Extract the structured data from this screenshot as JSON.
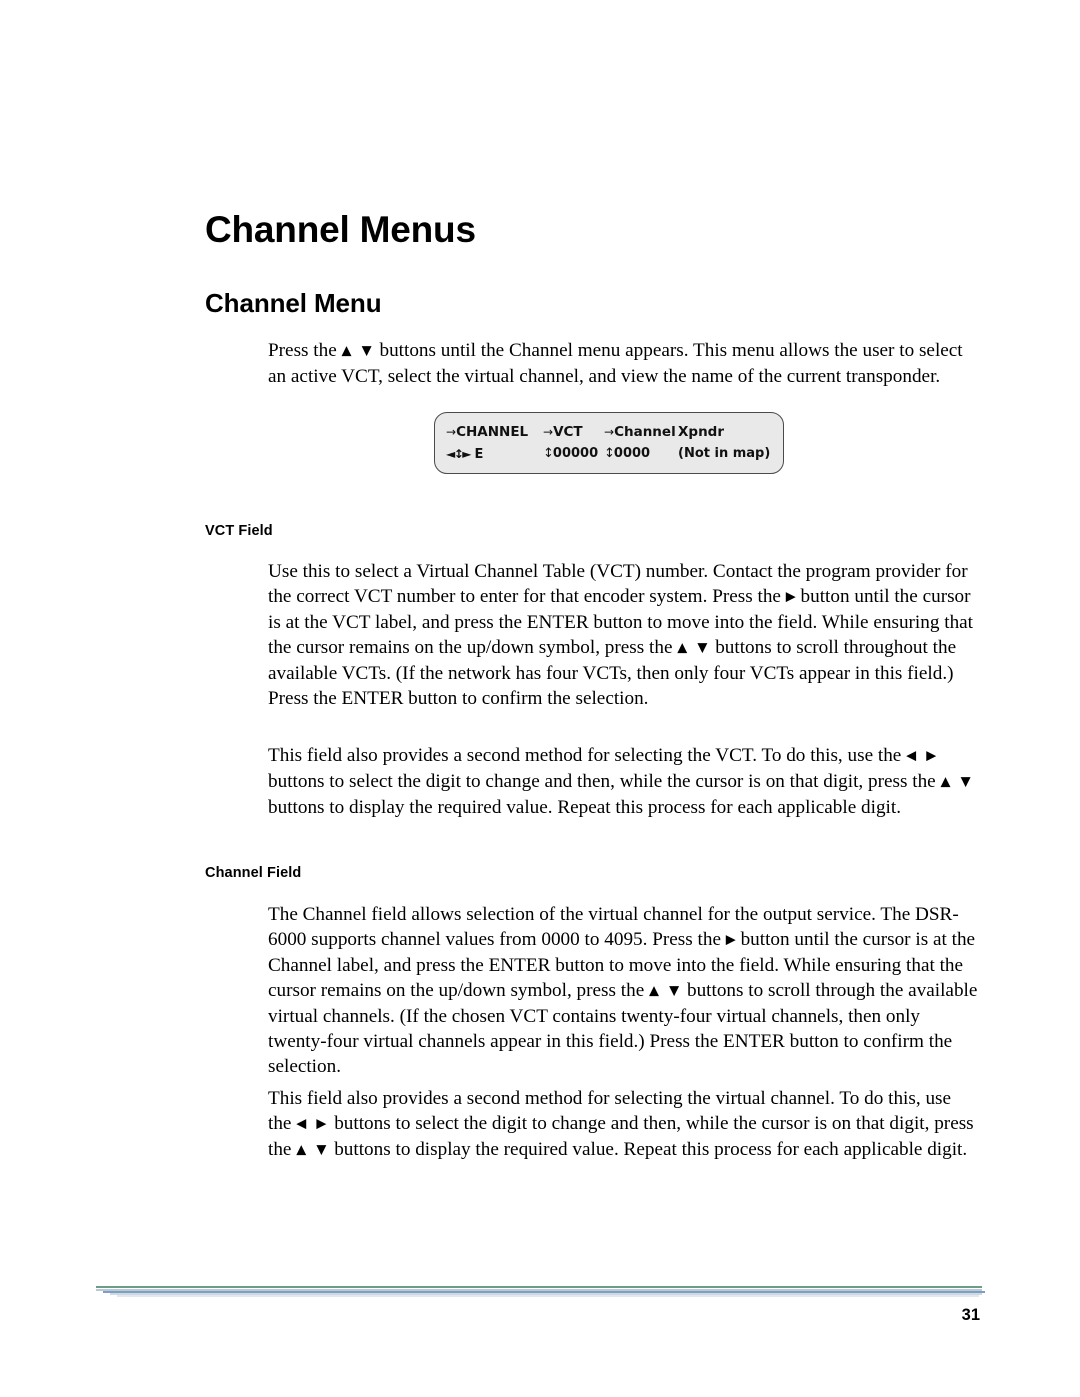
{
  "document": {
    "chapter_title": "Channel Menus",
    "section_title": "Channel Menu",
    "page_number": "31"
  },
  "intro": {
    "text_part1": "Press the",
    "arrows_updown": "▲ ▼",
    "text_part2": "buttons until the Channel menu appears. This menu allows the user to select an active VCT, select the virtual channel, and view the name of the current transponder."
  },
  "lcd": {
    "labels": {
      "col1_arrow": "→",
      "col1": "CHANNEL",
      "col2_arrow": "→",
      "col2": "VCT",
      "col3_arrow": "→",
      "col3": "Channel",
      "col4": "Xpndr"
    },
    "values": {
      "col1_nav": "◄↕►",
      "col1": "E",
      "col2_nav": "↕",
      "col2": "00000",
      "col3_nav": "↕",
      "col3": "0000",
      "col4": "(Not in map)"
    }
  },
  "vct_field": {
    "heading": "VCT Field",
    "paragraph1_a": "Use this to select a Virtual Channel Table (VCT) number. Contact the program provider for the correct VCT number to enter for that encoder system. Press the",
    "paragraph1_arrow_right": "▶",
    "paragraph1_b": "button until the cursor is at the VCT label, and press the ENTER button to move into the field. While ensuring that the cursor remains on the up/down symbol, press the",
    "paragraph1_arrows_updown": "▲ ▼",
    "paragraph1_c": "buttons to scroll throughout the available VCTs. (If the network has four VCTs, then only four VCTs appear in this field.) Press the ENTER button to confirm the selection.",
    "paragraph2_a": "This field also provides a second method for selecting the VCT. To do this, use the",
    "paragraph2_arrows_leftright": "◀  ▶",
    "paragraph2_b": "buttons to select the digit to change and then, while the cursor is on that digit, press the",
    "paragraph2_arrows_updown": "▲ ▼",
    "paragraph2_c": "buttons to display the required value. Repeat this process for each applicable digit."
  },
  "channel_field": {
    "heading": "Channel Field",
    "paragraph1_a": "The Channel field allows selection of the virtual channel for the output service. The DSR-6000 supports channel values from 0000 to 4095. Press the",
    "paragraph1_arrow_right": "▶",
    "paragraph1_b": "button until the cursor is at the Channel label, and press the ENTER button to move into the field. While ensuring that the cursor remains on the up/down symbol, press the",
    "paragraph1_arrows_updown": "▲ ▼",
    "paragraph1_c": "buttons to scroll through the available virtual channels. (If the chosen VCT contains twenty-four virtual channels, then only twenty-four virtual channels appear in this field.) Press the ENTER button to confirm the selection.",
    "paragraph2_a": "This field also provides a second method for selecting the virtual channel. To do this, use the",
    "paragraph2_arrows_leftright": "◀  ▶",
    "paragraph2_b": "buttons to select the digit to change and then, while the cursor is on that digit, press the",
    "paragraph2_arrows_updown": "▲ ▼",
    "paragraph2_c": "buttons to display the required value. Repeat this process for each applicable digit."
  },
  "colors": {
    "rule_green": "#6f9c86",
    "rule_blue": "#7f9fc0",
    "lcd_background": "#e9e9e9",
    "lcd_border": "#4a4a4a"
  }
}
